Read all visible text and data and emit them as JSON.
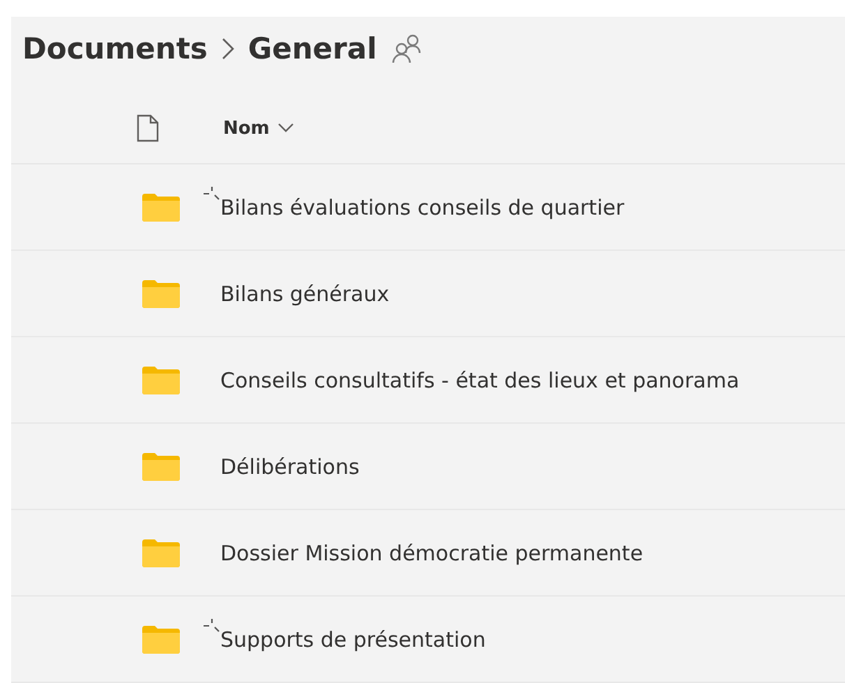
{
  "breadcrumb": {
    "items": [
      "Documents",
      "General"
    ]
  },
  "columns": {
    "name": "Nom"
  },
  "rows": [
    {
      "name": "Bilans évaluations conseils de quartier",
      "new": true
    },
    {
      "name": "Bilans généraux",
      "new": false
    },
    {
      "name": "Conseils consultatifs - état des lieux et panorama",
      "new": false
    },
    {
      "name": "Délibérations",
      "new": false
    },
    {
      "name": "Dossier Mission démocratie permanente",
      "new": false
    },
    {
      "name": "Supports de présentation",
      "new": true
    }
  ]
}
